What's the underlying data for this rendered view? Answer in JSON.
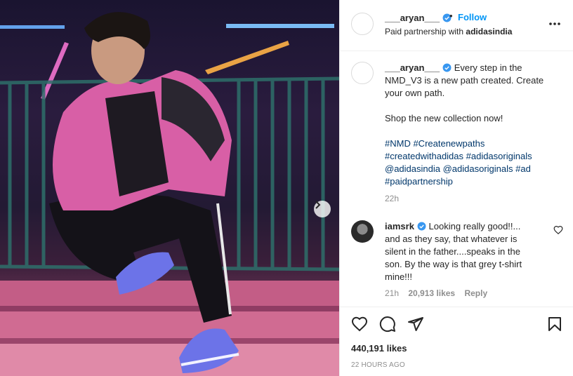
{
  "post": {
    "image_alt": "Photo of a young man in a pink and black jacket crouching on stairs wearing purple sneakers under neon lights",
    "next_icon": "chevron-right-icon"
  },
  "header": {
    "username": "___aryan___",
    "follow_label": "Follow",
    "separator": "•",
    "partnership_prefix": "Paid partnership with",
    "partner_name": "adidasindia"
  },
  "caption": {
    "username": "___aryan___",
    "text_line1": "Every step in the NMD_V3 is a new path created. Create your own path.",
    "text_line2": "Shop the new collection now!",
    "hashtags": "#NMD #Createnewpaths #createdwithadidas #adidasoriginals @adidasindia @adidasoriginals #ad #paidpartnership",
    "time": "22h"
  },
  "comment": {
    "username": "iamsrk",
    "text": "Looking really good!!... and as they say, that whatever is silent in the father....speaks in the son. By the way is that grey t-shirt mine!!!",
    "time": "21h",
    "likes": "20,913 likes",
    "reply_label": "Reply"
  },
  "footer": {
    "likes": "440,191 likes",
    "timestamp": "22 HOURS AGO"
  },
  "colors": {
    "accent": "#0095f6",
    "verified": "#3897f0",
    "text": "#262626",
    "muted": "#8e8e8e",
    "hashtag": "#00376b"
  }
}
